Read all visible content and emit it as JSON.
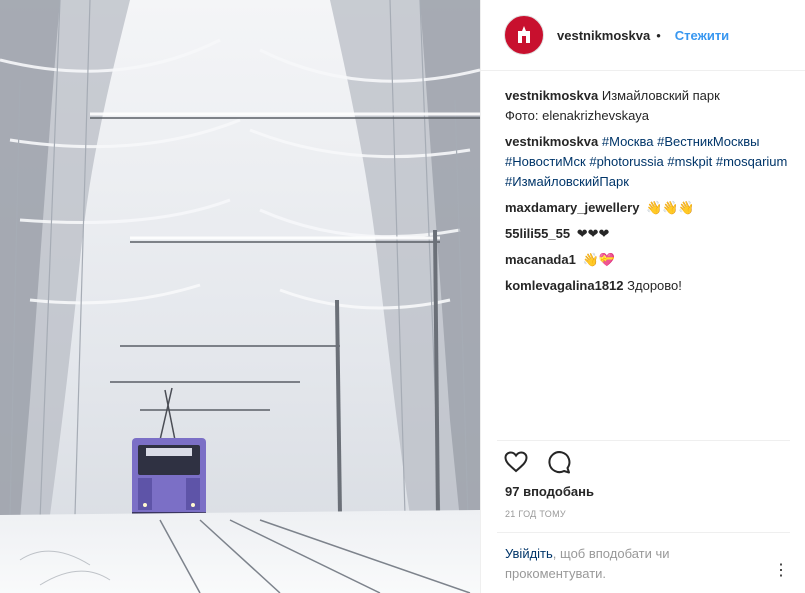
{
  "post": {
    "username": "vestnikmoskva",
    "separator": "•",
    "follow_label": "Стежити",
    "caption": {
      "user": "vestnikmoskva",
      "line1": "Измайловский парк",
      "line2": "Фото: elenakrizhevskaya"
    },
    "hashtags_comment": {
      "user": "vestnikmoskva",
      "tags": [
        "#Москва",
        "#ВестникМосквы",
        "#НовостиМск",
        "#photorussia",
        "#mskpit",
        "#mosqarium",
        "#ИзмайловскийПарк"
      ]
    },
    "comments": [
      {
        "user": "maxdamary_jewellery",
        "text": "👋👋👋"
      },
      {
        "user": "55lili55_55",
        "text": "❤❤❤"
      },
      {
        "user": "macanada1",
        "text": "👋💝"
      },
      {
        "user": "komlevagalina1812",
        "text": "Здорово!"
      }
    ],
    "likes": "97 вподобань",
    "time": "21 ГОД ТОМУ",
    "login_link": "Увійдіть",
    "login_text": ", щоб вподобати чи прокоментувати.",
    "more_icon": "⋮"
  },
  "icons": {
    "like": "heart-icon",
    "comment": "comment-icon",
    "more": "more-options-icon"
  },
  "colors": {
    "link_blue": "#3897f0",
    "hashtag": "#003569",
    "muted": "#999999",
    "avatar": "#c8102e",
    "tram": "#7b6fc6"
  }
}
